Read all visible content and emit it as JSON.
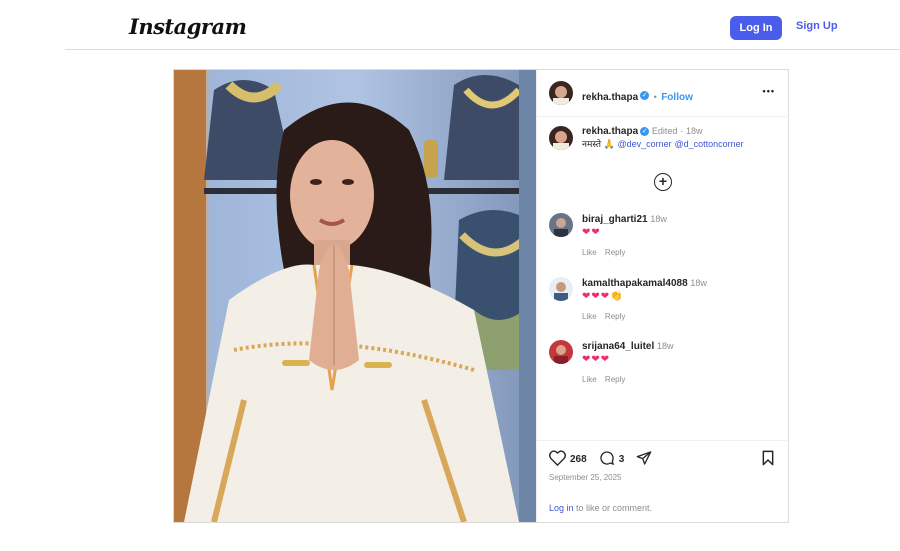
{
  "header": {
    "logo": "Instagram",
    "login_label": "Log In",
    "signup_label": "Sign Up"
  },
  "post": {
    "username": "rekha.thapa",
    "follow_label": "Follow",
    "more_label": "•••",
    "caption": {
      "username": "rekha.thapa",
      "edited": "Edited",
      "separator": "·",
      "time": "18w",
      "text_prefix": "नमस्ते 🙏",
      "mention1": "@dev_corner",
      "mention2": "@d_cottoncorner"
    },
    "load_more_label": "⊕",
    "comments": [
      {
        "username": "biraj_gharti21",
        "time": "18w",
        "text": "❤❤",
        "like": "Like",
        "reply": "Reply"
      },
      {
        "username": "kamalthapakamal4088",
        "time": "18w",
        "text": "❤❤❤👏",
        "like": "Like",
        "reply": "Reply"
      },
      {
        "username": "srijana64_luitel",
        "time": "18w",
        "text": "❤❤❤",
        "like": "Like",
        "reply": "Reply"
      }
    ],
    "likes_count": "268",
    "comments_count": "3",
    "date": "September 25, 2025",
    "login_prompt_link": "Log in",
    "login_prompt_rest": " to like or comment."
  },
  "colors": {
    "accent": "#4a5dea",
    "link": "#3897f0",
    "heart": "#ed2f6a"
  }
}
